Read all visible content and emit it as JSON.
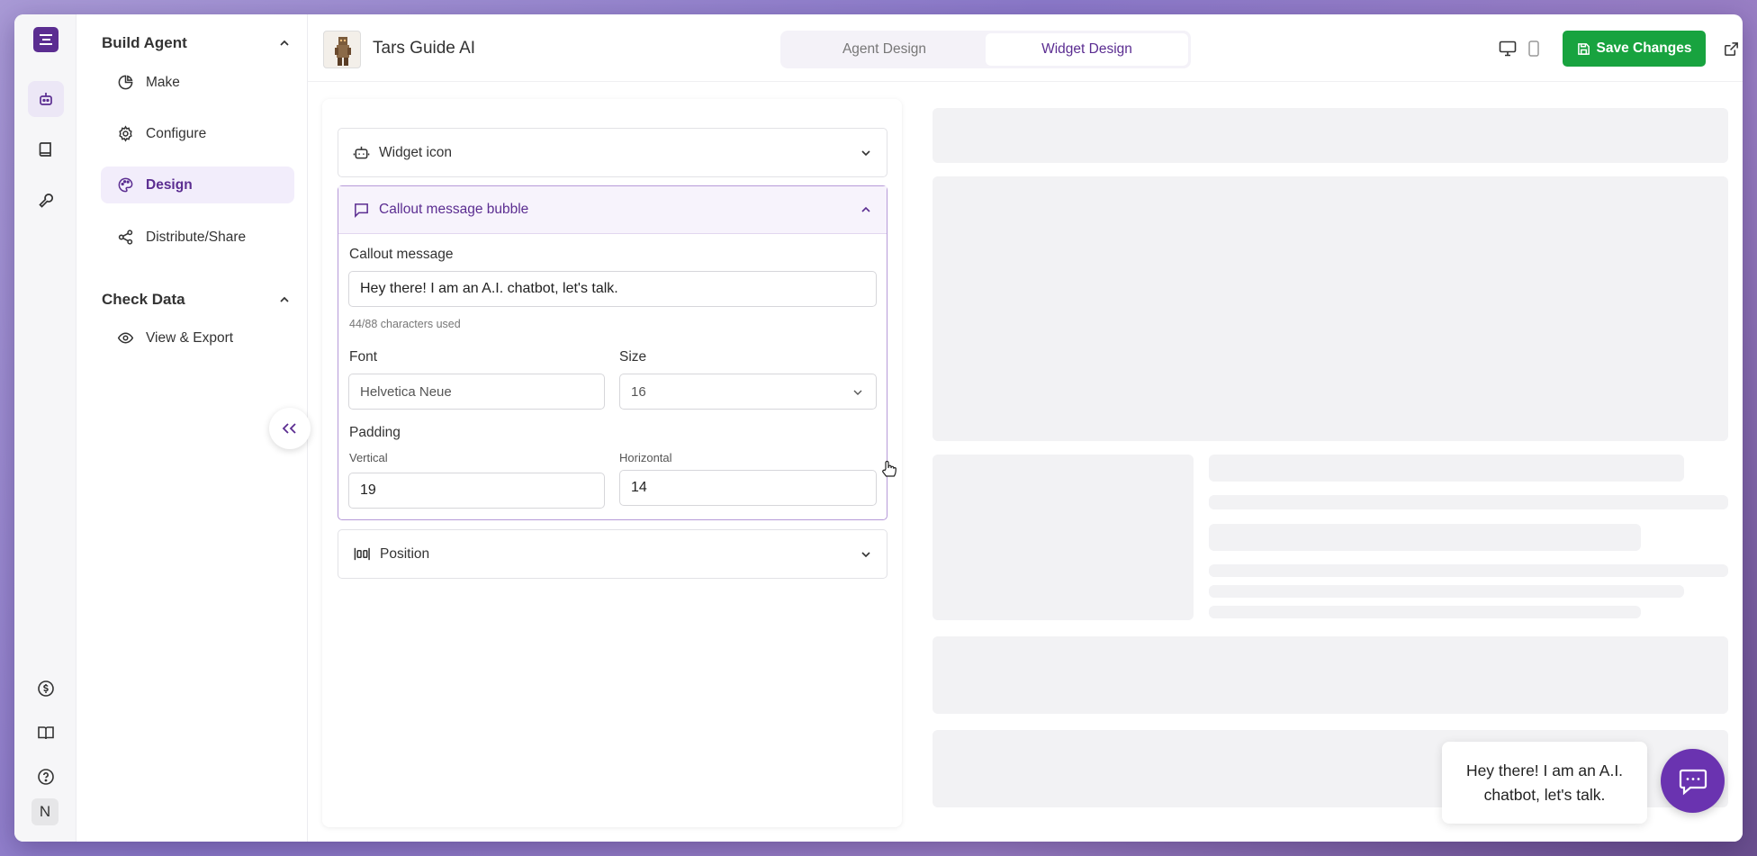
{
  "app": {
    "agent_name": "Tars Guide AI",
    "accent_color": "#5b2d91",
    "save_color": "#18a33f"
  },
  "rail": {
    "avatar_initial": "N",
    "icons": [
      "app-logo-icon",
      "robot-icon",
      "book-icon",
      "wrench-icon",
      "billing-icon",
      "docs-icon",
      "help-icon"
    ]
  },
  "sidebar": {
    "build_agent": {
      "title": "Build Agent",
      "items": [
        {
          "label": "Make",
          "icon": "pie-chart-icon"
        },
        {
          "label": "Configure",
          "icon": "gear-icon"
        },
        {
          "label": "Design",
          "icon": "palette-icon",
          "active": true
        },
        {
          "label": "Distribute/Share",
          "icon": "share-icon"
        }
      ]
    },
    "check_data": {
      "title": "Check Data",
      "items": [
        {
          "label": "View & Export",
          "icon": "eye-icon"
        }
      ]
    }
  },
  "topbar": {
    "tabs": [
      {
        "label": "Agent Design",
        "active": false
      },
      {
        "label": "Widget Design",
        "active": true
      }
    ],
    "save_label": "Save Changes"
  },
  "config": {
    "widget_icon": {
      "title": "Widget icon"
    },
    "callout": {
      "title": "Callout message bubble",
      "message_label": "Callout message",
      "message_value": "Hey there! I am an A.I. chatbot, let's talk.",
      "char_count": "44/88 characters used",
      "font_label": "Font",
      "font_value": "Helvetica Neue",
      "size_label": "Size",
      "size_value": "16",
      "padding_label": "Padding",
      "vertical_label": "Vertical",
      "vertical_value": "19",
      "horizontal_label": "Horizontal",
      "horizontal_value": "14"
    },
    "position": {
      "title": "Position"
    }
  },
  "preview": {
    "bubble_text": "Hey there! I am an A.I. chatbot, let's talk."
  }
}
